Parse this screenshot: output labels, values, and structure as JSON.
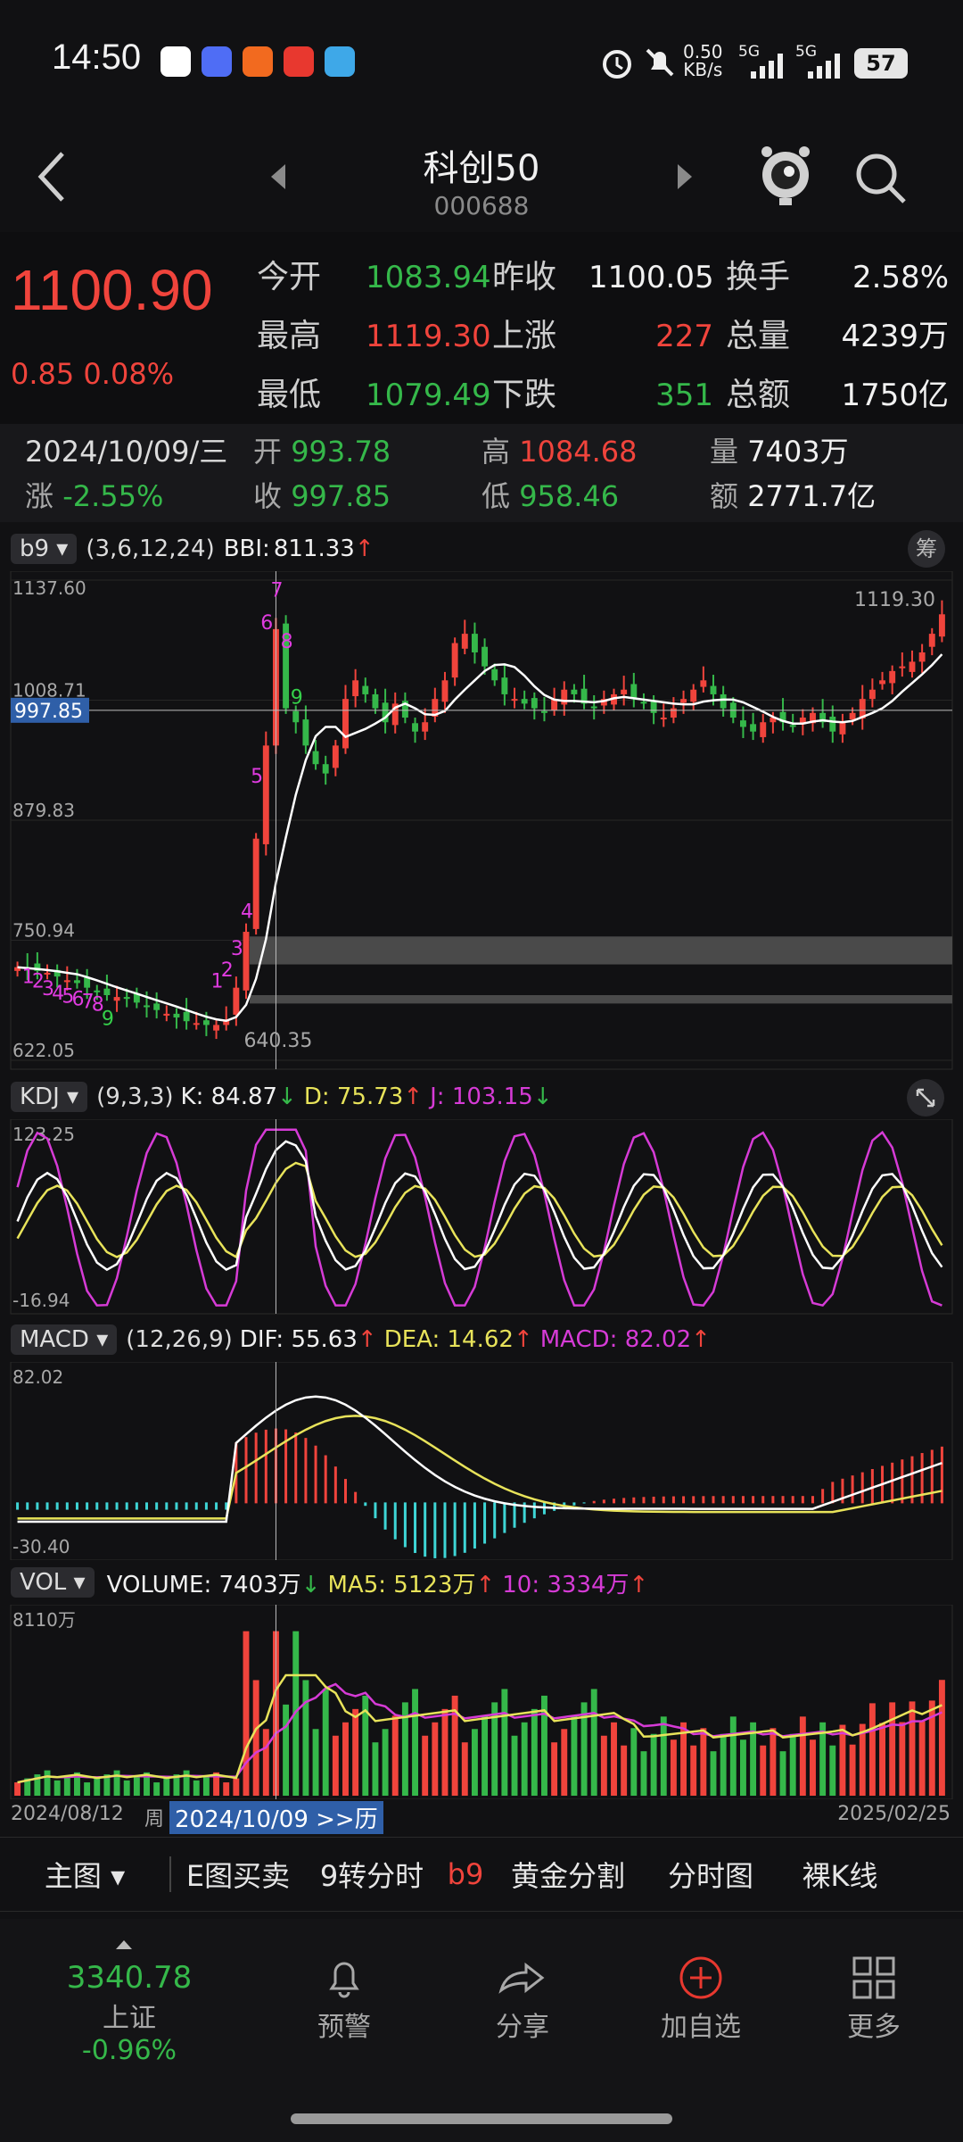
{
  "status": {
    "time": "14:50",
    "net_speed_value": "0.50",
    "net_speed_unit": "KB/s",
    "signal1": "5G",
    "signal2": "5G",
    "battery": "57"
  },
  "header": {
    "title": "科创50",
    "code": "000688"
  },
  "quote": {
    "price": "1100.90",
    "change": "0.85",
    "change_pct": "0.08%",
    "open_label": "今开",
    "open": "1083.94",
    "prev_close_label": "昨收",
    "prev_close": "1100.05",
    "turnover_label": "换手",
    "turnover": "2.58%",
    "high_label": "最高",
    "high": "1119.30",
    "up_label": "上涨",
    "up": "227",
    "volume_label": "总量",
    "volume": "4239万",
    "low_label": "最低",
    "low": "1079.49",
    "down_label": "下跌",
    "down": "351",
    "amount_label": "总额",
    "amount": "1750亿"
  },
  "day_info": {
    "date": "2024/10/09/三",
    "open_label": "开",
    "open": "993.78",
    "high_label": "高",
    "high": "1084.68",
    "vol_label": "量",
    "vol": "7403万",
    "chg_label": "涨",
    "chg": "-2.55%",
    "close_label": "收",
    "close": "997.85",
    "low_label": "低",
    "low": "958.46",
    "amt_label": "额",
    "amt": "2771.7亿"
  },
  "main_chart": {
    "indicator": "b9",
    "params": "(3,6,12,24)",
    "bbi_label": "BBI:",
    "bbi_value": "811.33",
    "chip_button": "筹",
    "y_ticks": [
      "1137.60",
      "1008.71",
      "879.83",
      "750.94",
      "622.05"
    ],
    "cursor_price": "997.85",
    "max_label": "1119.30",
    "min_label": "640.35",
    "td_labels": [
      "7",
      "6",
      "8",
      "9",
      "5",
      "4",
      "3",
      "2",
      "1",
      "9",
      "1",
      "2",
      "3",
      "4",
      "5",
      "6",
      "7",
      "8"
    ]
  },
  "chart_data": {
    "type": "candlestick",
    "x_start": "2024/08/12",
    "x_end": "2025/02/25",
    "cursor_date": "2024/10/09",
    "price_ylim": [
      622.05,
      1137.6
    ],
    "close_approx": [
      722,
      720,
      718,
      716,
      712,
      708,
      705,
      700,
      696,
      692,
      690,
      688,
      684,
      680,
      676,
      672,
      668,
      664,
      662,
      660,
      660,
      665,
      700,
      760,
      860,
      960,
      1085,
      1000,
      985,
      960,
      940,
      930,
      960,
      1010,
      1030,
      1015,
      1000,
      985,
      1005,
      990,
      975,
      985,
      1010,
      1030,
      1070,
      1080,
      1060,
      1045,
      1030,
      1015,
      1010,
      1005,
      1000,
      995,
      1010,
      1020,
      1015,
      1005,
      1000,
      1010,
      1015,
      1020,
      1010,
      1005,
      995,
      990,
      1000,
      1010,
      1020,
      1030,
      1015,
      1000,
      990,
      980,
      975,
      985,
      990,
      985,
      980,
      990,
      995,
      985,
      975,
      985,
      995,
      1010,
      1020,
      1030,
      1040,
      1045,
      1050,
      1060,
      1080,
      1100.9
    ],
    "kdj": {
      "label": "KDJ",
      "params": "(9,3,3)",
      "k": "84.87",
      "d": "75.73",
      "j": "103.15",
      "ylim": [
        -16.94,
        123.25
      ]
    },
    "macd": {
      "label": "MACD",
      "params": "(12,26,9)",
      "dif": "55.63",
      "dea": "14.62",
      "macd": "82.02",
      "ylim": [
        -30.4,
        82.02
      ]
    },
    "volume": {
      "label": "VOL",
      "volume": "7403万",
      "ma5": "5123万",
      "ma10": "3334万",
      "ymax_label": "8110万"
    }
  },
  "tabs": [
    "主图",
    "E图买卖",
    "9转分时",
    "b9",
    "黄金分割",
    "分时图",
    "裸K线"
  ],
  "tabs_active": 3,
  "footer_date_overlay": "2024/10/09 >>历",
  "footer_left_partial": "周",
  "bottom_nav": {
    "index_value": "3340.78",
    "index_name": "上证",
    "index_change": "-0.96%",
    "alert": "预警",
    "share": "分享",
    "add": "加自选",
    "more": "更多"
  },
  "colors": {
    "up": "#f0443c",
    "down": "#35b84a",
    "bbi": "#ffffff",
    "dea": "#e8e35a",
    "j": "#d63bd6"
  }
}
